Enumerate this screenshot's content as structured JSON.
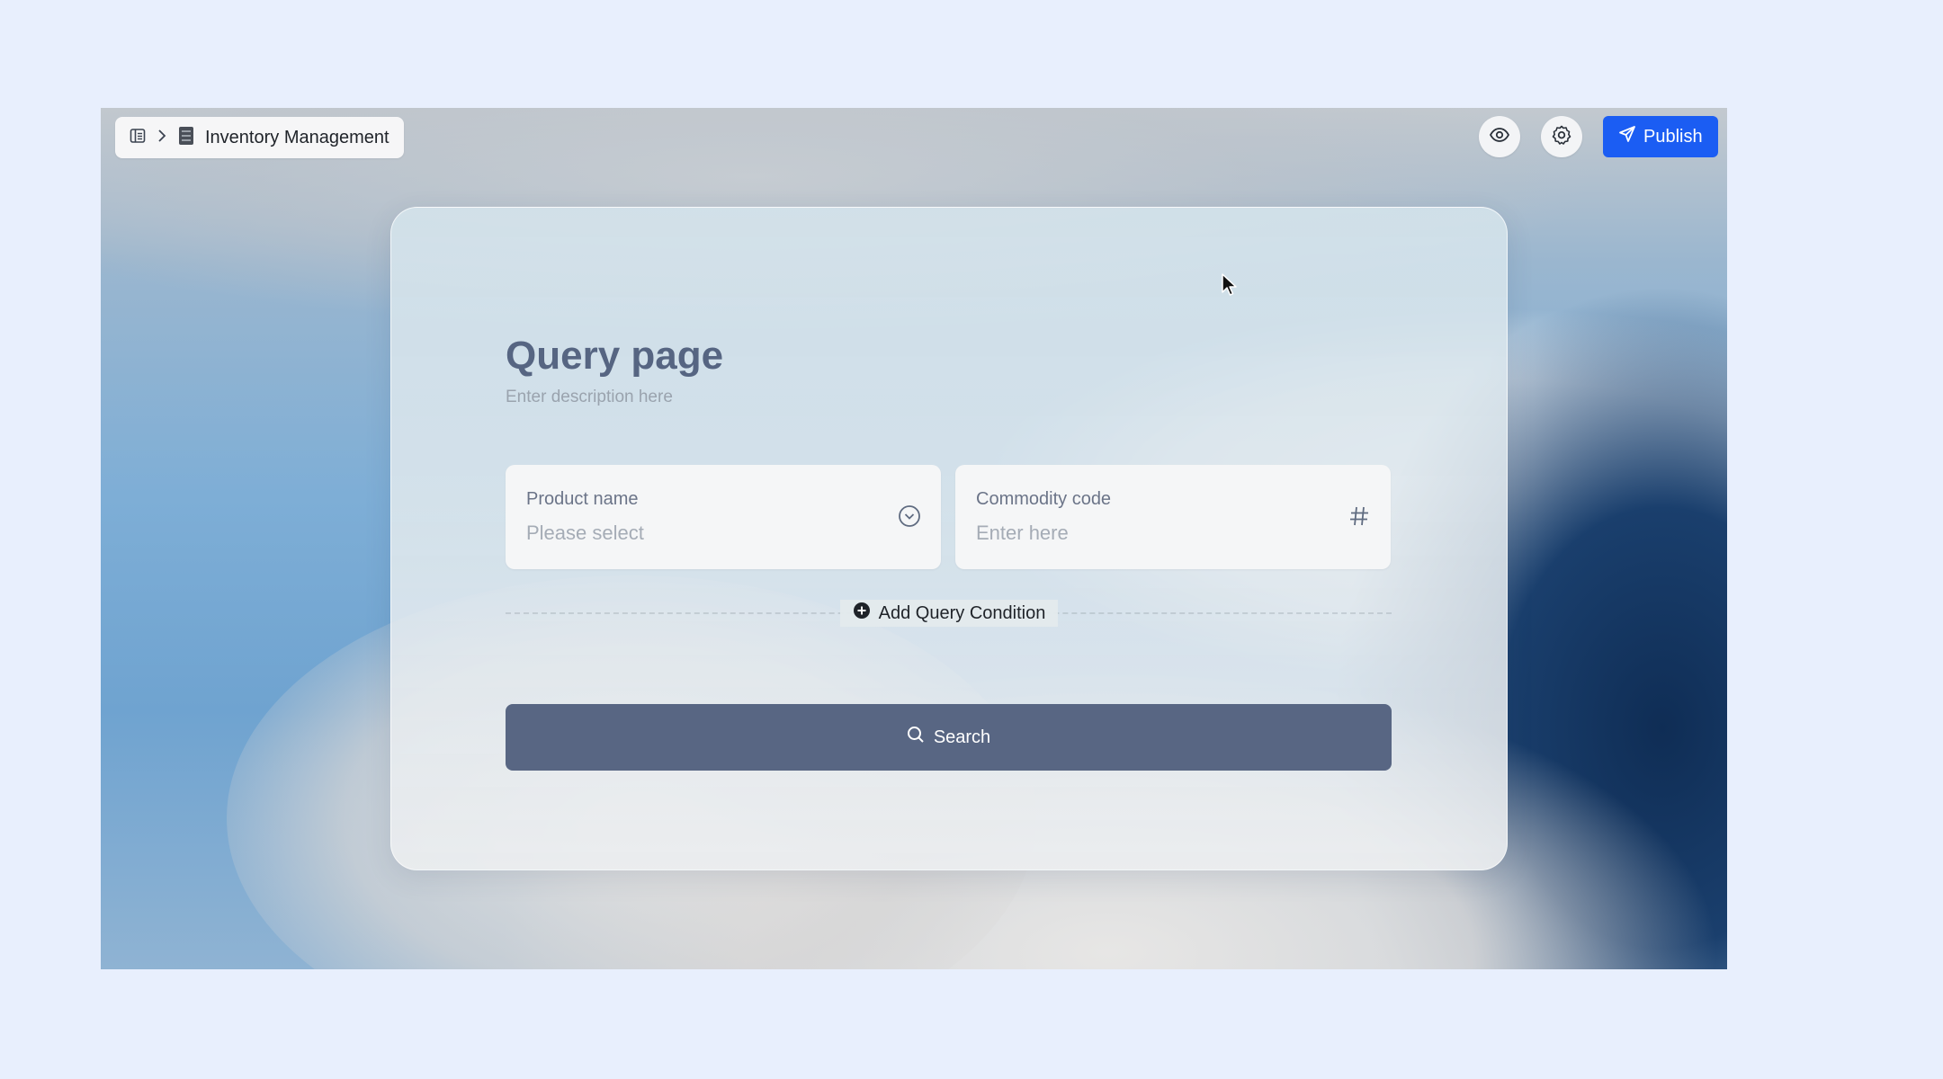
{
  "header": {
    "breadcrumb_title": "Inventory Management",
    "publish_label": "Publish"
  },
  "page": {
    "title": "Query page",
    "description": "Enter description here"
  },
  "fields": [
    {
      "label": "Product name",
      "placeholder": "Please select",
      "icon": "chevron-down-circle-icon"
    },
    {
      "label": "Commodity code",
      "placeholder": "Enter here",
      "icon": "hash-icon"
    }
  ],
  "add_condition_label": "Add Query Condition",
  "search_label": "Search",
  "colors": {
    "page_bg": "#e8effd",
    "publish": "#1b5df3",
    "search_button": "#586683",
    "title": "#566582"
  }
}
